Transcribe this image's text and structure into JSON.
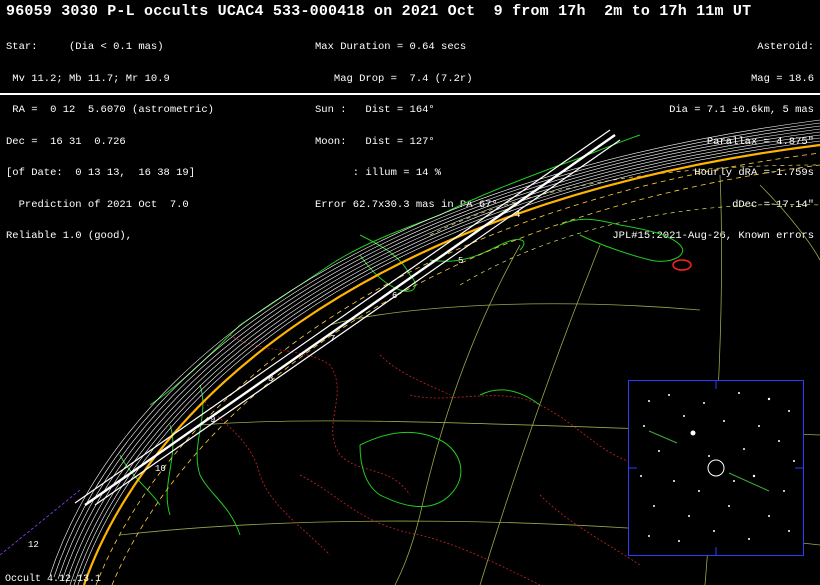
{
  "title": "96059 3030 P-L occults UCAC4 533-000418 on 2021 Oct  9 from 17h  2m to 17h 11m UT",
  "star_block": [
    "Star:     (Dia < 0.1 mas)",
    " Mv 11.2; Mb 11.7; Mr 10.9",
    " RA =  0 12  5.6070 (astrometric)",
    "Dec =  16 31  0.726",
    "[of Date:  0 13 13,  16 38 19]",
    "  Prediction of 2021 Oct  7.0",
    "Reliable 1.0 (good),"
  ],
  "event_block": [
    "Max Duration = 0.64 secs",
    "   Mag Drop =  7.4 (7.2r)",
    "Sun :   Dist = 164°",
    "Moon:   Dist = 127°",
    "      : illum = 14 %",
    "Error 62.7x30.3 mas in PA 67°"
  ],
  "asteroid_block": [
    "Asteroid:",
    "Mag = 18.6",
    "Dia = 7.1 ±0.6km, 5 mas",
    "Parallax = 4.875\"",
    "Hourly dRA =-1.759s",
    "dDec =-17.14\"",
    "JPL#15:2021-Aug-26, Known errors"
  ],
  "time_ticks": [
    "4",
    "5",
    "6",
    "7",
    "8",
    "9",
    "10",
    "12"
  ],
  "footer": "Occult 4.12.13.1",
  "colors": {
    "path": "#ffffff",
    "coast": "#22cc22",
    "borders": "#cc2222",
    "graticule": "#9aa84a",
    "limit": "#ffb400",
    "inset_border": "#2a3bff",
    "target": "#ff2020"
  }
}
